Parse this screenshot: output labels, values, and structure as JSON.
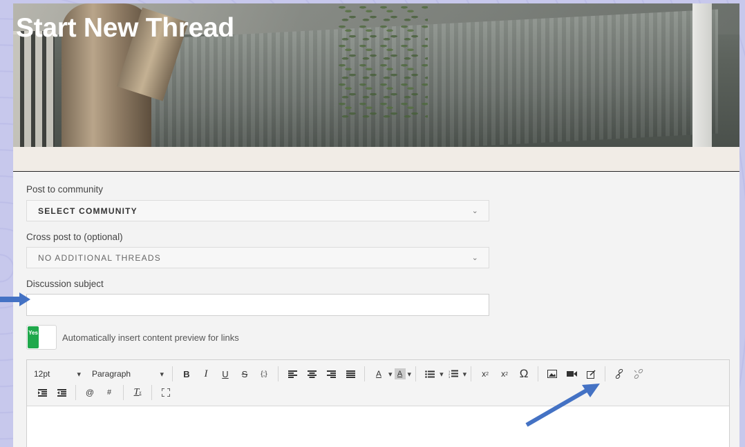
{
  "page": {
    "title": "Start New Thread"
  },
  "form": {
    "post_to_label": "Post to community",
    "community_select": "SELECT COMMUNITY",
    "cross_post_label": "Cross post to (optional)",
    "cross_post_select": "NO ADDITIONAL THREADS",
    "subject_label": "Discussion subject",
    "subject_value": "",
    "toggle_state": "Yes",
    "toggle_text": "Automatically insert content preview for links"
  },
  "toolbar": {
    "font_size": "12pt",
    "block_format": "Paragraph",
    "text_color_label": "A",
    "bg_color_label": "A",
    "mention_symbol": "@",
    "hashtag_symbol": "#",
    "omega_symbol": "Ω"
  },
  "colors": {
    "toggle_on": "#1fa84b",
    "annotation_arrow": "#4472c4",
    "page_background": "#c7c8ec"
  }
}
